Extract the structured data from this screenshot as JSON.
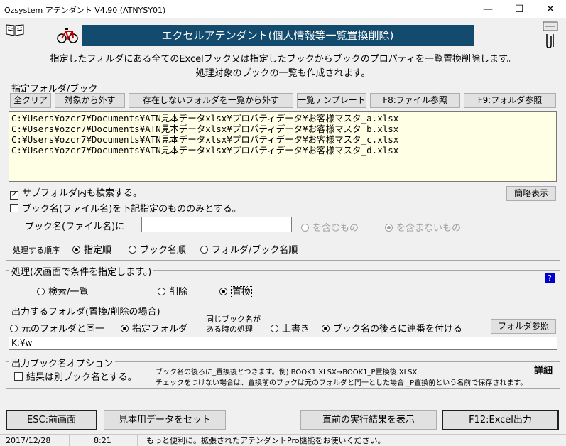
{
  "window": {
    "title": "Ozsystem アテンダント V4.90 (ATNYSY01)",
    "minimize": "—",
    "maximize": "☐",
    "close": "✕"
  },
  "banner": "エクセルアテンダント(個人情報等一覧置換削除)",
  "description": {
    "line1": "指定したフォルダにある全てのExcelブック又は指定したブックからブックのプロパティを一覧置換削除します。",
    "line2": "処理対象のブックの一覧も作成されます。"
  },
  "folder_group": {
    "title": "指定フォルダ/ブック",
    "buttons": {
      "clear_all": "全クリア",
      "exclude": "対象から外す",
      "remove_missing": "存在しないフォルダを一覧から外す",
      "list_template": "一覧テンプレート",
      "f8": "F8:ファイル参照",
      "f9": "F9:フォルダ参照"
    },
    "paths": [
      "C:¥Users¥ozcr7¥Documents¥ATN見本データxlsx¥プロパティデータ¥お客様マスタ_a.xlsx",
      "C:¥Users¥ozcr7¥Documents¥ATN見本データxlsx¥プロパティデータ¥お客様マスタ_b.xlsx",
      "C:¥Users¥ozcr7¥Documents¥ATN見本データxlsx¥プロパティデータ¥お客様マスタ_c.xlsx",
      "C:¥Users¥ozcr7¥Documents¥ATN見本データxlsx¥プロパティデータ¥お客様マスタ_d.xlsx"
    ],
    "subfolder_label": "サブフォルダ内も検索する。",
    "subfolder_checked": true,
    "simple_view": "簡略表示",
    "bookname_only_label": "ブック名(ファイル名)を下記指定のもののみとする。",
    "bookname_only_checked": false,
    "bookname_field_label": "ブック名(ファイル名)に",
    "bookname_value": "",
    "contains": "を含むもの",
    "not_contains": "を含まないもの",
    "order_label": "処理する順序",
    "order_options": [
      "指定順",
      "ブック名順",
      "フォルダ/ブック名順"
    ],
    "order_selected": 0
  },
  "process_group": {
    "title": "処理(次画面で条件を指定します。)",
    "options": [
      "検索/一覧",
      "削除",
      "置換"
    ],
    "selected": 2,
    "help": "?"
  },
  "output_group": {
    "title": "出力するフォルダ(置換/削除の場合)",
    "same_folder": "元のフォルダと同一",
    "specified_folder": "指定フォルダ",
    "same_name_line1": "同じブック名が",
    "same_name_line2": "ある時の処理",
    "overwrite": "上書き",
    "append_number": "ブック名の後ろに連番を付ける",
    "folder_ref": "フォルダ参照",
    "path": "K:¥w"
  },
  "bookname_option_group": {
    "title": "出力ブック名オプション",
    "separate_label": "結果は別ブック名とする。",
    "note1": "ブック名の後ろに_置換後とつきます。例) BOOK1.XLSX→BOOK1_P置換後.XLSX",
    "note2": "チェックをつけない場合は、置換前のブックは元のフォルダと同一とした場合 _P置換前という名前で保存されます。",
    "detail": "詳細"
  },
  "bottom_buttons": {
    "esc": "ESC:前画面",
    "sample": "見本用データをセット",
    "last_result": "直前の実行結果を表示",
    "f12": "F12:Excel出力"
  },
  "status": {
    "date": "2017/12/28",
    "time": "8:21",
    "message": "もっと便利に。拡張されたアテンダントPro機能をお使いください。"
  },
  "icons": [
    "book-icon",
    "bicycle-icon",
    "clip-icon"
  ]
}
